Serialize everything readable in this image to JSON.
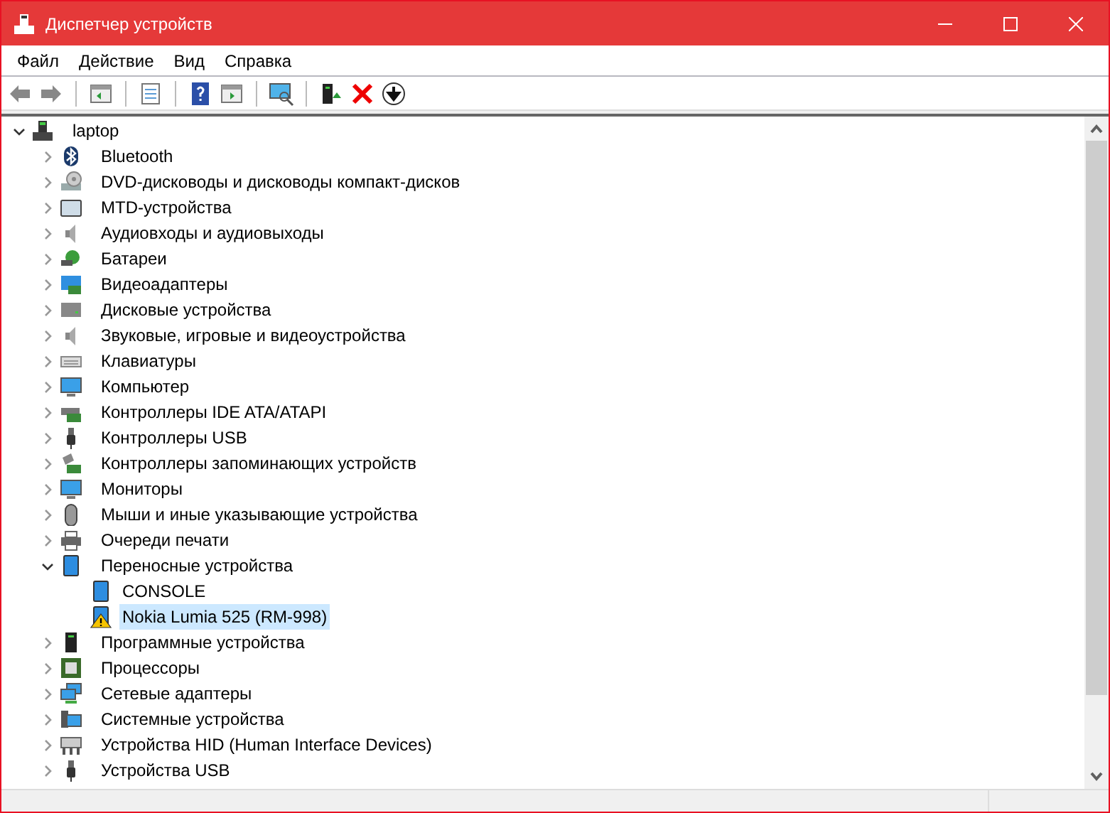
{
  "window": {
    "title": "Диспетчер устройств"
  },
  "menu": [
    {
      "label": "Файл"
    },
    {
      "label": "Действие"
    },
    {
      "label": "Вид"
    },
    {
      "label": "Справка"
    }
  ],
  "tree": [
    {
      "label": "laptop",
      "expanded": true,
      "selected": false,
      "children": [
        {
          "label": "Bluetooth",
          "expanded": false,
          "selected": false
        },
        {
          "label": "DVD-дисководы и дисководы компакт-дисков",
          "expanded": false,
          "selected": false
        },
        {
          "label": "MTD-устройства",
          "expanded": false,
          "selected": false
        },
        {
          "label": "Аудиовходы и аудиовыходы",
          "expanded": false,
          "selected": false
        },
        {
          "label": "Батареи",
          "expanded": false,
          "selected": false
        },
        {
          "label": "Видеоадаптеры",
          "expanded": false,
          "selected": false
        },
        {
          "label": "Дисковые устройства",
          "expanded": false,
          "selected": false
        },
        {
          "label": "Звуковые, игровые и видеоустройства",
          "expanded": false,
          "selected": false
        },
        {
          "label": "Клавиатуры",
          "expanded": false,
          "selected": false
        },
        {
          "label": "Компьютер",
          "expanded": false,
          "selected": false
        },
        {
          "label": "Контроллеры IDE ATA/ATAPI",
          "expanded": false,
          "selected": false
        },
        {
          "label": "Контроллеры USB",
          "expanded": false,
          "selected": false
        },
        {
          "label": "Контроллеры запоминающих устройств",
          "expanded": false,
          "selected": false
        },
        {
          "label": "Мониторы",
          "expanded": false,
          "selected": false
        },
        {
          "label": "Мыши и иные указывающие устройства",
          "expanded": false,
          "selected": false
        },
        {
          "label": "Очереди печати",
          "expanded": false,
          "selected": false
        },
        {
          "label": "Переносные устройства",
          "expanded": true,
          "selected": false,
          "children": [
            {
              "label": "CONSOLE",
              "selected": false,
              "warning": false
            },
            {
              "label": "Nokia Lumia 525 (RM-998)",
              "selected": true,
              "warning": true
            }
          ]
        },
        {
          "label": "Программные устройства",
          "expanded": false,
          "selected": false
        },
        {
          "label": "Процессоры",
          "expanded": false,
          "selected": false
        },
        {
          "label": "Сетевые адаптеры",
          "expanded": false,
          "selected": false
        },
        {
          "label": "Системные устройства",
          "expanded": false,
          "selected": false
        },
        {
          "label": "Устройства HID (Human Interface Devices)",
          "expanded": false,
          "selected": false
        },
        {
          "label": "Устройства USB",
          "expanded": false,
          "selected": false
        }
      ]
    }
  ]
}
